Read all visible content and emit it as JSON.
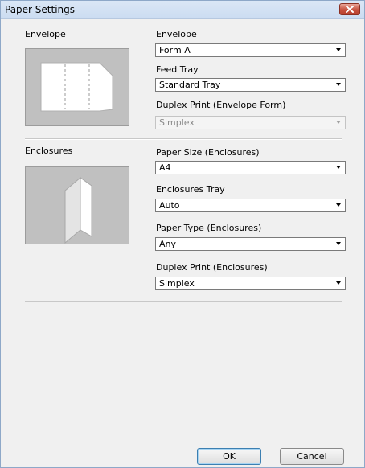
{
  "window": {
    "title": "Paper Settings"
  },
  "envelope": {
    "section_label": "Envelope",
    "envelope_label": "Envelope",
    "envelope_value": "Form A",
    "feed_tray_label": "Feed Tray",
    "feed_tray_value": "Standard Tray",
    "duplex_label": "Duplex Print (Envelope Form)",
    "duplex_value": "Simplex"
  },
  "enclosures": {
    "section_label": "Enclosures",
    "paper_size_label": "Paper Size (Enclosures)",
    "paper_size_value": "A4",
    "tray_label": "Enclosures Tray",
    "tray_value": "Auto",
    "paper_type_label": "Paper Type (Enclosures)",
    "paper_type_value": "Any",
    "duplex_label": "Duplex Print (Enclosures)",
    "duplex_value": "Simplex"
  },
  "buttons": {
    "ok": "OK",
    "cancel": "Cancel"
  },
  "icons": {
    "close": "close-icon",
    "dropdown": "chevron-down-icon"
  },
  "colors": {
    "titlebar": "#cbdcf1",
    "close": "#c7513f",
    "preview_bg": "#c0c0c0"
  }
}
